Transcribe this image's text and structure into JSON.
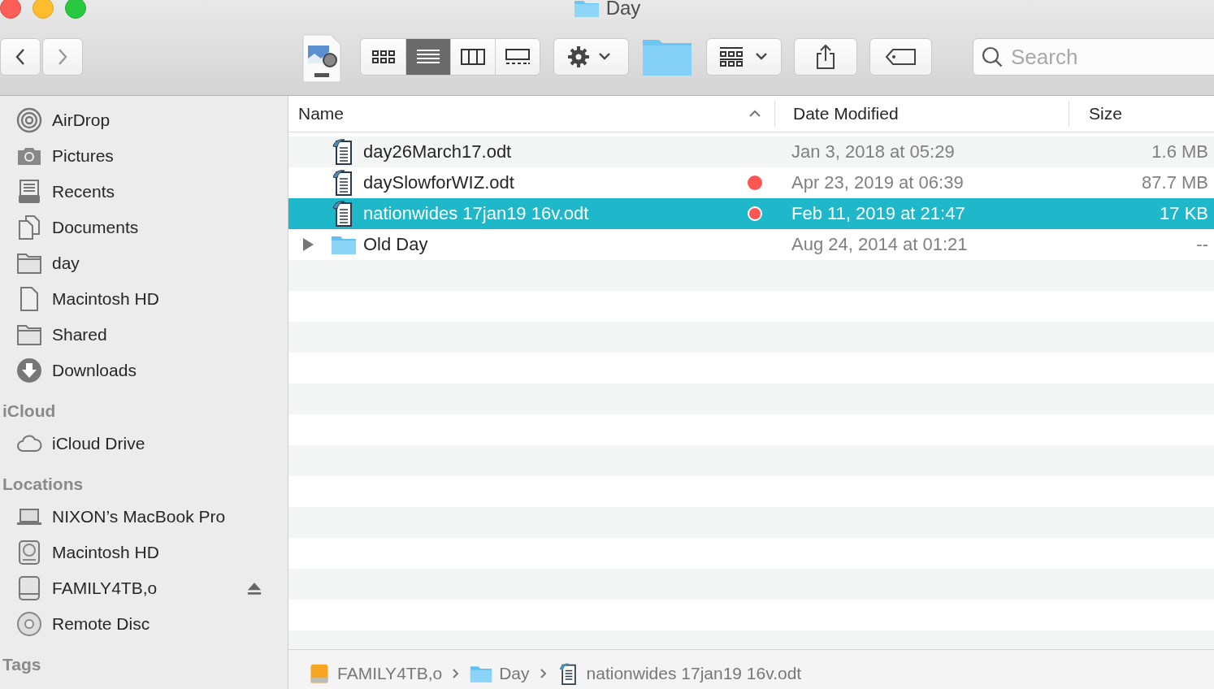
{
  "window": {
    "title": "Day"
  },
  "toolbar": {
    "view_modes": [
      {
        "selected": false
      },
      {
        "selected": true
      },
      {
        "selected": false
      },
      {
        "selected": false
      }
    ],
    "search": {
      "placeholder": "Search"
    }
  },
  "sidebar": {
    "sections": [
      {
        "items": [
          {
            "label": "AirDrop"
          },
          {
            "label": "Pictures"
          },
          {
            "label": "Recents"
          },
          {
            "label": "Documents"
          },
          {
            "label": "day"
          },
          {
            "label": "Macintosh HD"
          },
          {
            "label": "Shared"
          },
          {
            "label": "Downloads"
          }
        ]
      },
      {
        "title": "iCloud",
        "items": [
          {
            "label": "iCloud Drive"
          }
        ]
      },
      {
        "title": "Locations",
        "items": [
          {
            "label": "NIXON’s MacBook Pro",
            "ejectable": false
          },
          {
            "label": "Macintosh HD",
            "ejectable": false
          },
          {
            "label": "FAMILY4TB,o",
            "ejectable": true
          },
          {
            "label": "Remote Disc",
            "ejectable": false
          }
        ]
      },
      {
        "title": "Tags"
      }
    ]
  },
  "file_list": {
    "columns": [
      {
        "label": "Name",
        "sorted": true
      },
      {
        "label": "Date Modified",
        "sorted": false
      },
      {
        "label": "Size",
        "sorted": false
      }
    ],
    "rows": [
      {
        "kind": "document",
        "name": "day26March17.odt",
        "date": "Jan 3, 2018 at 05:29",
        "size": "1.6 MB",
        "selected": false
      },
      {
        "kind": "document",
        "name": "daySlowforWIZ.odt",
        "date": "Apr 23, 2019 at 06:39",
        "size": "87.7 MB",
        "selected": false,
        "color": "#fc5652"
      },
      {
        "kind": "document",
        "name": "nationwides 17jan19 16v.odt",
        "date": "Feb 11, 2019 at 21:47",
        "size": "17 KB",
        "selected": true,
        "color": "#fc5652"
      },
      {
        "kind": "folder",
        "name": "Old Day",
        "date": "Aug 24, 2014 at 01:21",
        "size": "--",
        "selected": false,
        "expanded": false
      }
    ]
  },
  "path_bar": [
    {
      "label": "FAMILY4TB,o"
    },
    {
      "label": "Day"
    },
    {
      "label": "nationwides 17jan19 16v.odt"
    }
  ]
}
